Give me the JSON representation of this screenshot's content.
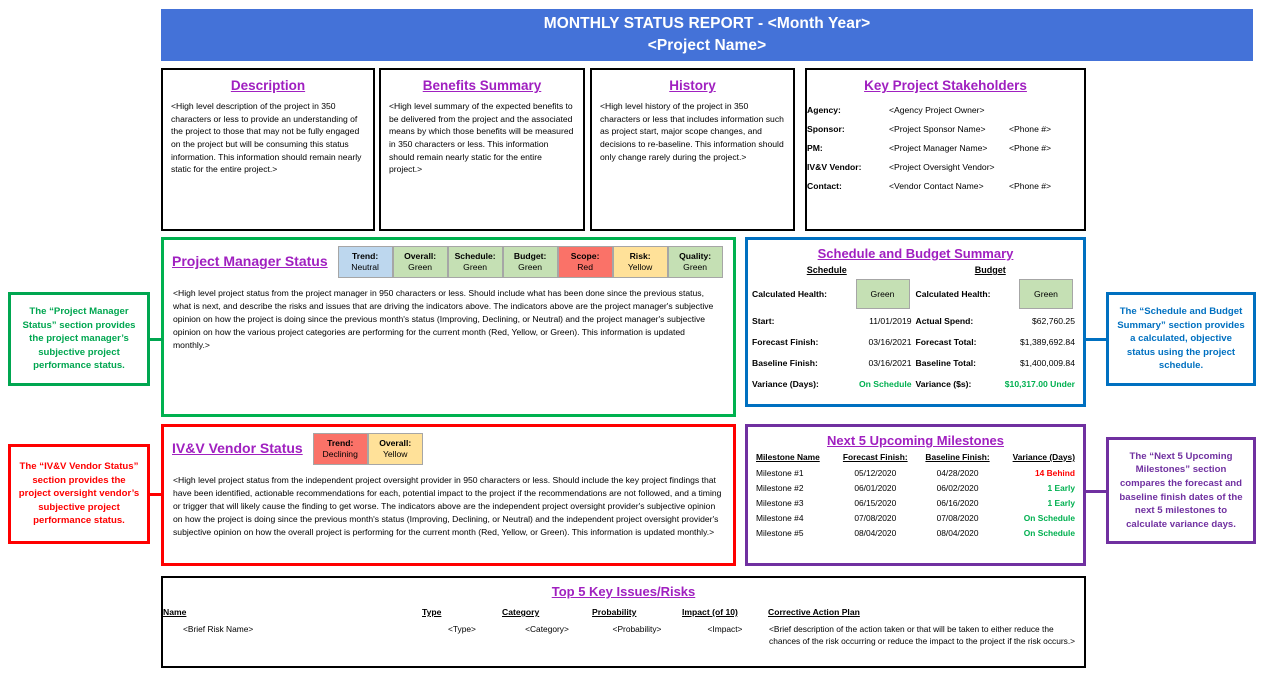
{
  "header": {
    "line1": "MONTHLY STATUS REPORT - <Month Year>",
    "line2": "<Project Name>",
    "banner_color": "#4472d8"
  },
  "cards": {
    "description": {
      "title": "Description",
      "body": "<High level description of the project in 350 characters or less to provide an understanding of the project to those that may not be fully engaged on the project but will be consuming this status information. This information should remain nearly static for the entire project.>"
    },
    "benefits": {
      "title": "Benefits Summary",
      "body": "<High level summary of the expected benefits to be delivered from the project and the associated means by which those benefits will be measured in 350 characters or less. This information should remain nearly static for the entire project.>"
    },
    "history": {
      "title": "History",
      "body": "<High level history of the project in 350 characters or less that includes information such as project start, major scope changes, and decisions to re-baseline. This information should only change rarely during the project.>"
    },
    "stakeholders": {
      "title": "Key Project Stakeholders",
      "rows": [
        {
          "label": "Agency:",
          "name": "<Agency Project Owner>",
          "phone": ""
        },
        {
          "label": "Sponsor:",
          "name": "<Project Sponsor Name>",
          "phone": "<Phone #>"
        },
        {
          "label": "PM:",
          "name": "<Project Manager Name>",
          "phone": "<Phone #>"
        },
        {
          "label": "IV&V Vendor:",
          "name": "<Project Oversight Vendor>",
          "phone": ""
        },
        {
          "label": "Contact:",
          "name": "<Vendor Contact Name>",
          "phone": "<Phone #>"
        }
      ]
    }
  },
  "pm_status": {
    "title": "Project Manager Status",
    "border_color": "#00b14f",
    "chips": [
      {
        "key": "Trend:",
        "value": "Neutral",
        "color": "#bdd7ee"
      },
      {
        "key": "Overall:",
        "value": "Green",
        "color": "#c5e0b4"
      },
      {
        "key": "Schedule:",
        "value": "Green",
        "color": "#c5e0b4"
      },
      {
        "key": "Budget:",
        "value": "Green",
        "color": "#c5e0b4"
      },
      {
        "key": "Scope:",
        "value": "Red",
        "color": "#fa7268"
      },
      {
        "key": "Risk:",
        "value": "Yellow",
        "color": "#ffe199"
      },
      {
        "key": "Quality:",
        "value": "Green",
        "color": "#c5e0b4"
      }
    ],
    "body": "<High level project status from the project manager in 950 characters or less. Should include what has been done since the previous status, what is next, and describe the risks and issues that are driving the indicators above. The indicators above are the project manager's subjective opinion on how the project is doing since the previous month's status (Improving, Declining, or Neutral) and the project manager's subjective opinion on how the various project categories are performing for the current month (Red, Yellow, or Green). This information is updated monthly.>"
  },
  "ivv_status": {
    "title": "IV&V Vendor Status",
    "border_color": "#fe0000",
    "chips": [
      {
        "key": "Trend:",
        "value": "Declining",
        "color": "#fa7268"
      },
      {
        "key": "Overall:",
        "value": "Yellow",
        "color": "#ffe199"
      }
    ],
    "body": "<High level project status from the independent project oversight provider in 950 characters or less. Should include the key project findings that have been identified, actionable recommendations for each, potential impact to the project if the recommendations are not followed, and a timing or trigger that will likely cause the finding to get worse. The indicators above are the independent project oversight provider's subjective opinion on how the project is doing since the previous month's status (Improving, Declining, or Neutral) and the independent project oversight provider's subjective opinion on how the overall project is performing for the current month (Red, Yellow, or Green). This information is updated monthly.>"
  },
  "schedule_budget": {
    "title": "Schedule and Budget Summary",
    "border_color": "#0070c0",
    "schedule": {
      "heading": "Schedule",
      "health_label": "Calculated Health:",
      "health_value": "Green",
      "rows": [
        {
          "label": "Start:",
          "value": "11/01/2019",
          "style": "plain"
        },
        {
          "label": "Forecast Finish:",
          "value": "03/16/2021",
          "style": "plain"
        },
        {
          "label": "Baseline Finish:",
          "value": "03/16/2021",
          "style": "plain"
        },
        {
          "label": "Variance (Days):",
          "value": "On Schedule",
          "style": "green"
        }
      ]
    },
    "budget": {
      "heading": "Budget",
      "health_label": "Calculated Health:",
      "health_value": "Green",
      "rows": [
        {
          "label": "Actual Spend:",
          "value": "$62,760.25",
          "style": "plain"
        },
        {
          "label": "Forecast Total:",
          "value": "$1,389,692.84",
          "style": "plain"
        },
        {
          "label": "Baseline Total:",
          "value": "$1,400,009.84",
          "style": "plain"
        },
        {
          "label": "Variance ($s):",
          "value": "$10,317.00 Under",
          "style": "green"
        }
      ]
    }
  },
  "milestones": {
    "title": "Next 5 Upcoming Milestones",
    "border_color": "#7030a0",
    "columns": [
      "Milestone Name",
      "Forecast Finish:",
      "Baseline Finish:",
      "Variance (Days)"
    ],
    "rows": [
      {
        "name": "Milestone #1",
        "forecast": "05/12/2020",
        "baseline": "04/28/2020",
        "variance": "14 Behind",
        "style": "red"
      },
      {
        "name": "Milestone #2",
        "forecast": "06/01/2020",
        "baseline": "06/02/2020",
        "variance": "1 Early",
        "style": "green"
      },
      {
        "name": "Milestone #3",
        "forecast": "06/15/2020",
        "baseline": "06/16/2020",
        "variance": "1 Early",
        "style": "green"
      },
      {
        "name": "Milestone #4",
        "forecast": "07/08/2020",
        "baseline": "07/08/2020",
        "variance": "On Schedule",
        "style": "green"
      },
      {
        "name": "Milestone #5",
        "forecast": "08/04/2020",
        "baseline": "08/04/2020",
        "variance": "On Schedule",
        "style": "green"
      }
    ]
  },
  "risks": {
    "title": "Top 5 Key Issues/Risks",
    "columns": [
      "Name",
      "Type",
      "Category",
      "Probability",
      "Impact (of 10)",
      "Corrective Action Plan"
    ],
    "rows": [
      {
        "name": "<Brief Risk Name>",
        "type": "<Type>",
        "category": "<Category>",
        "probability": "<Probability>",
        "impact": "<Impact>",
        "plan": "<Brief description of the action taken or that will be taken to either reduce the chances of the risk occurring or reduce the impact to the project if the risk occurs.>"
      }
    ]
  },
  "callouts": {
    "pm": {
      "text": "The “Project Manager Status” section provides the project manager’s subjective project performance status.",
      "color": "#00a650"
    },
    "ivv": {
      "text": "The “IV&V Vendor Status” section provides the project oversight vendor’s subjective project performance status.",
      "color": "#fe0000"
    },
    "sb": {
      "text": "The “Schedule and Budget Summary” section provides a calculated, objective status using the project schedule.",
      "color": "#0070c0"
    },
    "ms": {
      "text": "The “Next 5 Upcoming Milestones” section compares the forecast and baseline finish dates of the next 5 milestones to calculate variance days.",
      "color": "#7030a0"
    }
  }
}
